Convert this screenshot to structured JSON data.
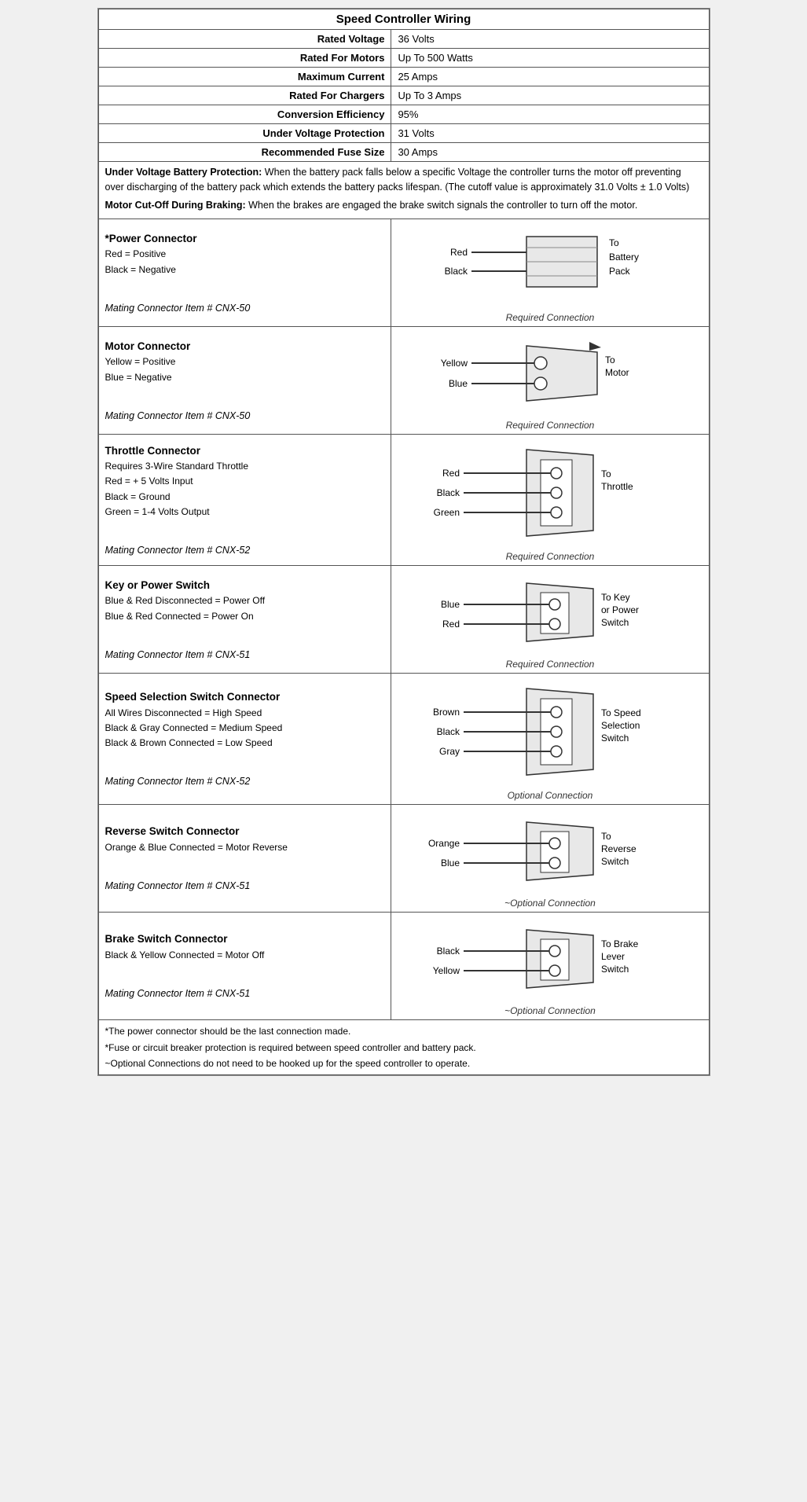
{
  "title": "Speed Controller Wiring",
  "specs": [
    {
      "label": "Rated Voltage",
      "value": "36 Volts"
    },
    {
      "label": "Rated For Motors",
      "value": "Up To 500 Watts"
    },
    {
      "label": "Maximum Current",
      "value": "25 Amps"
    },
    {
      "label": "Rated For Chargers",
      "value": "Up To 3 Amps"
    },
    {
      "label": "Conversion Efficiency",
      "value": "95%"
    },
    {
      "label": "Under Voltage Protection",
      "value": "31 Volts"
    },
    {
      "label": "Recommended Fuse Size",
      "value": "30 Amps"
    }
  ],
  "notes": [
    {
      "bold": "Under Voltage Battery Protection:",
      "text": " When the battery pack falls below a specific Voltage the controller turns the motor off preventing over discharging of the battery pack which extends the battery packs lifespan. (The cutoff value is approximately 31.0 Volts ± 1.0 Volts)"
    },
    {
      "bold": "Motor Cut-Off During Braking:",
      "text": " When the brakes are engaged the brake switch signals the controller to turn off the motor."
    }
  ],
  "connectors": [
    {
      "title": "*Power Connector",
      "lines": [
        "Red = Positive",
        "Black = Negative",
        "",
        "Mating Connector Item # CNX-50"
      ],
      "wires": [
        "Red",
        "Black"
      ],
      "to_label": "To\nBattery\nPack",
      "connection_type": "Required Connection",
      "connector_style": "battery"
    },
    {
      "title": "Motor Connector",
      "lines": [
        "Yellow = Positive",
        "Blue = Negative",
        "",
        "Mating Connector Item # CNX-50"
      ],
      "wires": [
        "Yellow",
        "Blue"
      ],
      "to_label": "To\nMotor",
      "connection_type": "Required Connection",
      "connector_style": "motor"
    },
    {
      "title": "Throttle Connector",
      "lines": [
        "Requires 3-Wire Standard Throttle",
        "Red = + 5 Volts Input",
        "Black = Ground",
        "Green = 1-4 Volts Output",
        "",
        "Mating Connector Item # CNX-52"
      ],
      "wires": [
        "Red",
        "Black",
        "Green"
      ],
      "to_label": "To\nThrottle",
      "connection_type": "Required Connection",
      "connector_style": "three-pin"
    },
    {
      "title": "Key or Power Switch",
      "lines": [
        "Blue & Red Disconnected = Power Off",
        "Blue & Red Connected = Power On",
        "",
        "Mating Connector Item # CNX-51"
      ],
      "wires": [
        "Blue",
        "Red"
      ],
      "to_label": "To Key\nor Power\nSwitch",
      "connection_type": "Required Connection",
      "connector_style": "two-pin"
    },
    {
      "title": "Speed Selection Switch Connector",
      "lines": [
        "All Wires Disconnected = High Speed",
        "Black & Gray Connected = Medium Speed",
        "Black & Brown Connected = Low Speed",
        "",
        "Mating Connector Item # CNX-52"
      ],
      "wires": [
        "Brown",
        "Black",
        "Gray"
      ],
      "to_label": "To Speed\nSelection\nSwitch",
      "connection_type": "Optional Connection",
      "connector_style": "three-pin"
    },
    {
      "title": "Reverse Switch Connector",
      "lines": [
        "Orange & Blue Connected = Motor Reverse",
        "",
        "Mating Connector Item # CNX-51"
      ],
      "wires": [
        "Orange",
        "Blue"
      ],
      "to_label": "To\nReverse\nSwitch",
      "connection_type": "~Optional Connection",
      "connector_style": "two-pin"
    },
    {
      "title": "Brake Switch Connector",
      "lines": [
        "Black & Yellow Connected = Motor Off",
        "",
        "Mating Connector Item # CNX-51"
      ],
      "wires": [
        "Black",
        "Yellow"
      ],
      "to_label": "To Brake\nLever\nSwitch",
      "connection_type": "~Optional Connection",
      "connector_style": "two-pin"
    }
  ],
  "footer_notes": [
    "*The power connector should be the last connection made.",
    "*Fuse or circuit breaker protection is required between speed controller and battery pack.",
    "~Optional Connections do not need to be hooked up for the speed controller to operate."
  ]
}
